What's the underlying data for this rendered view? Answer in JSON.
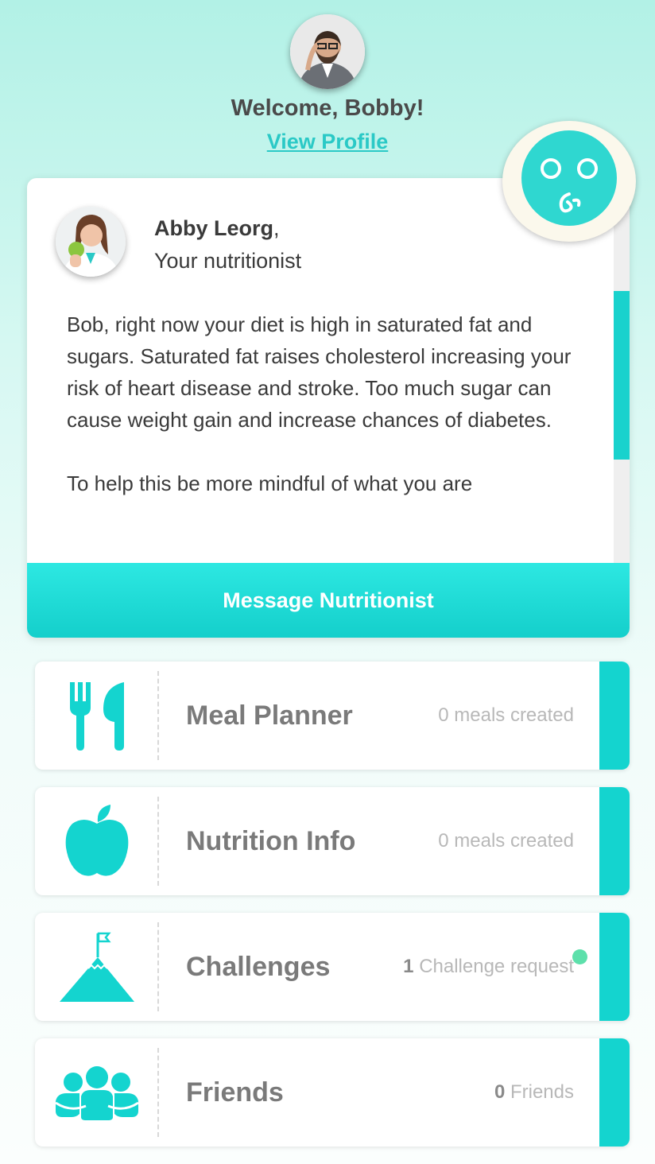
{
  "header": {
    "welcome": "Welcome, Bobby!",
    "view_profile": "View Profile"
  },
  "nutritionist": {
    "name": "Abby Leorg",
    "name_suffix": ",",
    "role": "Your nutritionist",
    "message_p1": "Bob, right now your diet is high in saturated fat and sugars. Saturated fat raises cholesterol increasing your risk of heart disease and stroke. Too much sugar can cause weight gain and increase chances of diabetes.",
    "message_p2": "To help this be more mindful of what you are",
    "button": "Message Nutritionist"
  },
  "tiles": [
    {
      "title": "Meal Planner",
      "count": "",
      "status": "0 meals created",
      "icon": "fork-knife-icon"
    },
    {
      "title": "Nutrition Info",
      "count": "",
      "status": "0 meals created",
      "icon": "apple-icon"
    },
    {
      "title": "Challenges",
      "count": "1",
      "status": " Challenge request",
      "icon": "mountain-flag-icon"
    },
    {
      "title": "Friends",
      "count": "0",
      "status": " Friends",
      "icon": "people-group-icon"
    }
  ],
  "colors": {
    "accent": "#14d4cf",
    "text": "#3a3a3a",
    "notification": "#5de0ab"
  }
}
